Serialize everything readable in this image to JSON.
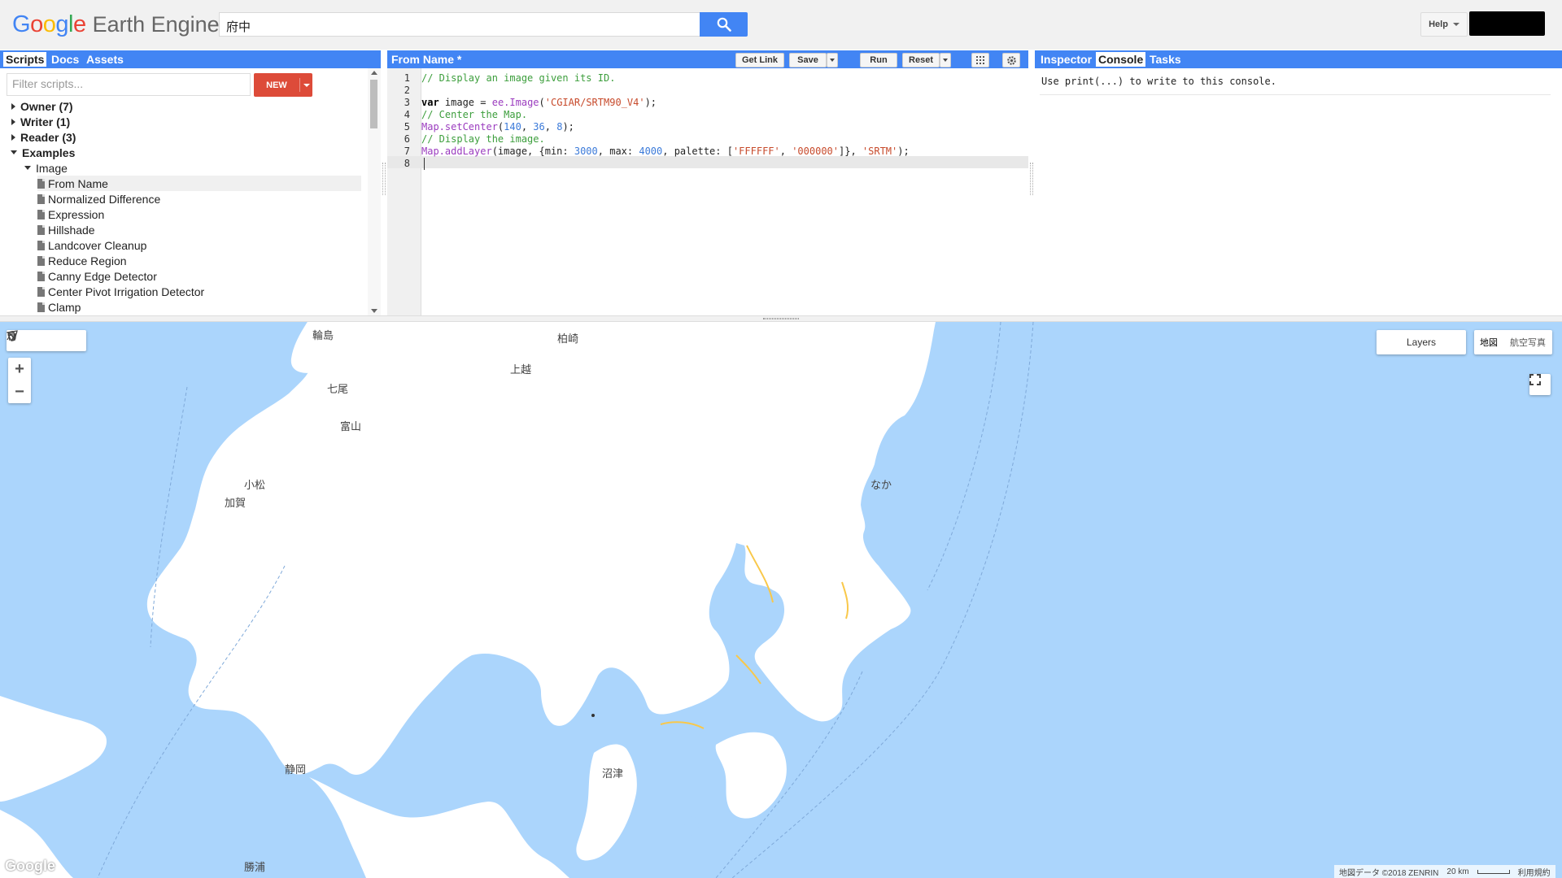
{
  "header": {
    "logo_letters": [
      "G",
      "o",
      "o",
      "g",
      "l",
      "e"
    ],
    "logo_colors": [
      "#4285f4",
      "#ea4335",
      "#fbbc05",
      "#4285f4",
      "#34a853",
      "#ea4335"
    ],
    "product": "Earth Engine",
    "search_value": "府中",
    "help_label": "Help"
  },
  "left_panel": {
    "tabs": [
      "Scripts",
      "Docs",
      "Assets"
    ],
    "active_tab": "Scripts",
    "filter_placeholder": "Filter scripts...",
    "new_label": "NEW",
    "tree": [
      {
        "label": "Owner",
        "count": "(7)",
        "kind": "folder",
        "expanded": false
      },
      {
        "label": "Writer",
        "count": "(1)",
        "kind": "folder",
        "expanded": false
      },
      {
        "label": "Reader",
        "count": "(3)",
        "kind": "folder",
        "expanded": false
      },
      {
        "label": "Examples",
        "count": "",
        "kind": "folder",
        "expanded": true
      },
      {
        "label": "Image",
        "count": "",
        "kind": "subfolder",
        "expanded": true
      },
      {
        "label": "From Name",
        "kind": "file",
        "selected": true
      },
      {
        "label": "Normalized Difference",
        "kind": "file"
      },
      {
        "label": "Expression",
        "kind": "file"
      },
      {
        "label": "Hillshade",
        "kind": "file"
      },
      {
        "label": "Landcover Cleanup",
        "kind": "file"
      },
      {
        "label": "Reduce Region",
        "kind": "file"
      },
      {
        "label": "Canny Edge Detector",
        "kind": "file"
      },
      {
        "label": "Center Pivot Irrigation Detector",
        "kind": "file"
      },
      {
        "label": "Clamp",
        "kind": "file"
      }
    ]
  },
  "editor": {
    "title": "From Name *",
    "buttons": {
      "get_link": "Get Link",
      "save": "Save",
      "run": "Run",
      "reset": "Reset"
    },
    "line_numbers": [
      "1",
      "2",
      "3",
      "4",
      "5",
      "6",
      "7",
      "8"
    ],
    "code": {
      "l1": "// Display an image given its ID.",
      "l3_kw": "var",
      "l3_a": " image = ",
      "l3_fn": "ee.Image",
      "l3_b": "(",
      "l3_str": "'CGIAR/SRTM90_V4'",
      "l3_c": ");",
      "l4": "// Center the Map.",
      "l5_fn": "Map.setCenter",
      "l5_a": "(",
      "l5_n1": "140",
      "l5_b": ", ",
      "l5_n2": "36",
      "l5_c": ", ",
      "l5_n3": "8",
      "l5_d": ");",
      "l6": "// Display the image.",
      "l7_fn": "Map.addLayer",
      "l7_a": "(image, {min: ",
      "l7_n1": "3000",
      "l7_b": ", max: ",
      "l7_n2": "4000",
      "l7_c": ", palette: [",
      "l7_s1": "'FFFFFF'",
      "l7_d": ", ",
      "l7_s2": "'000000'",
      "l7_e": "]}, ",
      "l7_s3": "'SRTM'",
      "l7_f": ");"
    }
  },
  "right_panel": {
    "tabs": [
      "Inspector",
      "Console",
      "Tasks"
    ],
    "active_tab": "Console",
    "console_text": "Use print(...) to write to this console."
  },
  "map": {
    "layers_label": "Layers",
    "map_types": [
      "地図",
      "航空写真"
    ],
    "labels": [
      "輪島",
      "柏崎",
      "上越",
      "七尾",
      "富山",
      "小松",
      "加賀",
      "なか",
      "沼津",
      "静岡",
      "勝浦"
    ],
    "attribution": "地図データ ©2018 ZENRIN",
    "scale": "20 km",
    "terms": "利用規約",
    "watermark": "Google",
    "colors": {
      "water": "#abd5fc",
      "land": "#ffffff",
      "road": "#f9c84a"
    }
  }
}
